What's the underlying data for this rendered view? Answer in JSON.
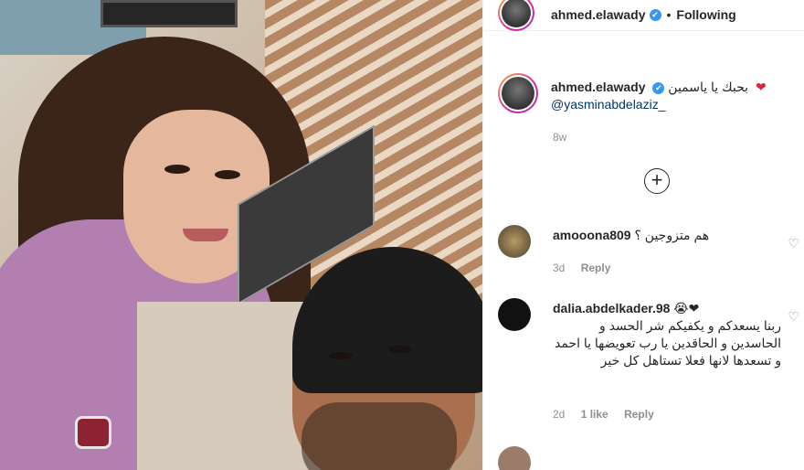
{
  "post": {
    "author": "ahmed.elawady",
    "verified_mark": "✔",
    "separator": "•",
    "follow_status": "Following"
  },
  "caption": {
    "username": "ahmed.elawady",
    "heart": "❤",
    "text": "بحبك يا ياسمين",
    "mention": "@yasminabdelaziz_",
    "time": "8w"
  },
  "add_comment_icon": "plus-circle-icon",
  "comments": [
    {
      "username": "amooona809",
      "text": "هم متزوجين ؟",
      "time": "3d",
      "reply": "Reply"
    },
    {
      "username": "dalia.abdelkader.98",
      "emoji": "😭❤",
      "text": "ربنا يسعدكم و يكفيكم شر الحسد و الحاسدين و الحاقدين يا رب تعويضها يا احمد و تسعدها لانها فعلا تستاهل كل خير",
      "time": "2d",
      "likes": "1 like",
      "reply": "Reply"
    }
  ],
  "colors": {
    "link": "#00376b",
    "muted": "#8e8e8e",
    "verified": "#3897f0",
    "heart": "#d7263d"
  }
}
